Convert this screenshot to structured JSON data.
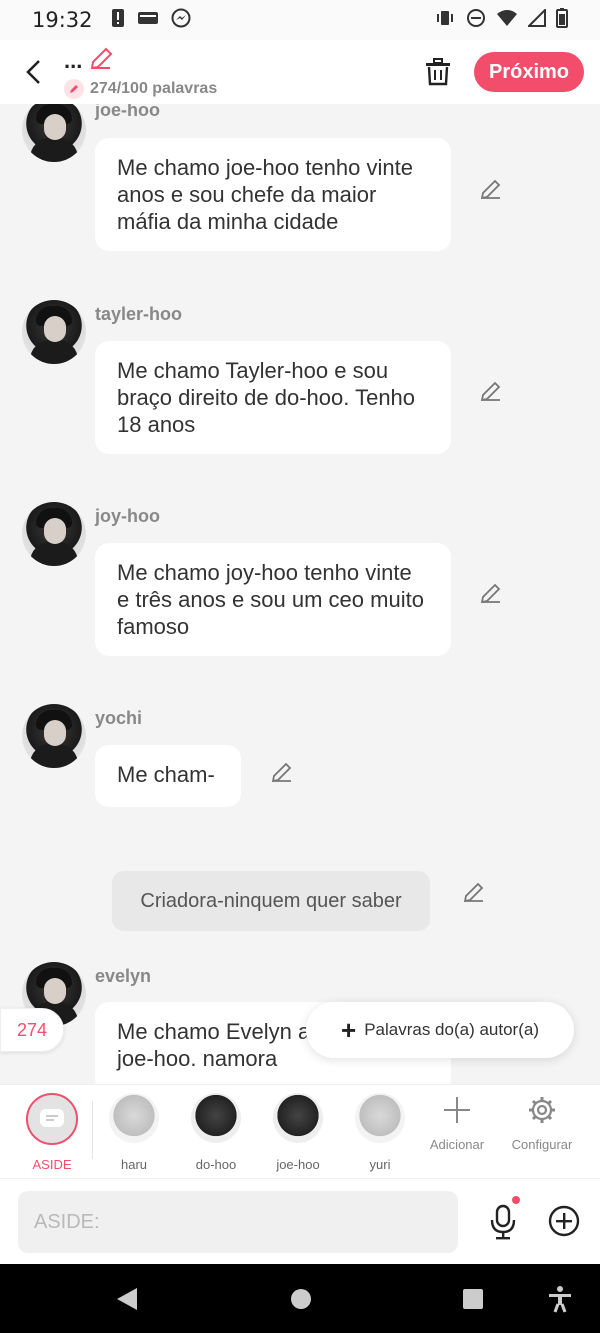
{
  "status_bar": {
    "time": "19:32",
    "left_icons": [
      "alert-icon",
      "card-icon",
      "messenger-icon"
    ],
    "right_icons": [
      "vibrate-icon",
      "dnd-icon",
      "wifi-icon",
      "signal-icon",
      "battery-icon"
    ]
  },
  "header": {
    "title": "...",
    "word_count": "274/100 palavras",
    "next_label": "Próximo",
    "accent_color": "#f24e6c"
  },
  "messages": [
    {
      "name": "joe-hoo",
      "text": "Me chamo joe-hoo tenho vinte anos e sou chefe da maior máfia da minha cidade"
    },
    {
      "name": "tayler-hoo",
      "text": "Me chamo Tayler-hoo e sou braço direito de do-hoo. Tenho 18 anos"
    },
    {
      "name": "joy-hoo",
      "text": "Me chamo joy-hoo tenho vinte e três anos e sou um ceo muito famoso"
    },
    {
      "name": "yochi",
      "text": "Me cham-"
    },
    {
      "name": "evelyn",
      "text": "Me chamo Evelyn assassina do joe-hoo. namora"
    }
  ],
  "narration": {
    "text": "Criadora-ninquem quer saber"
  },
  "overlay": {
    "counter": "274",
    "author_words_label": "Palavras do(a) autor(a)"
  },
  "characters": {
    "aside_label": "ASIDE",
    "items": [
      "haru",
      "do-hoo",
      "joe-hoo",
      "yuri"
    ],
    "add_label": "Adicionar",
    "settings_label": "Configurar"
  },
  "input": {
    "placeholder": "ASIDE:"
  }
}
